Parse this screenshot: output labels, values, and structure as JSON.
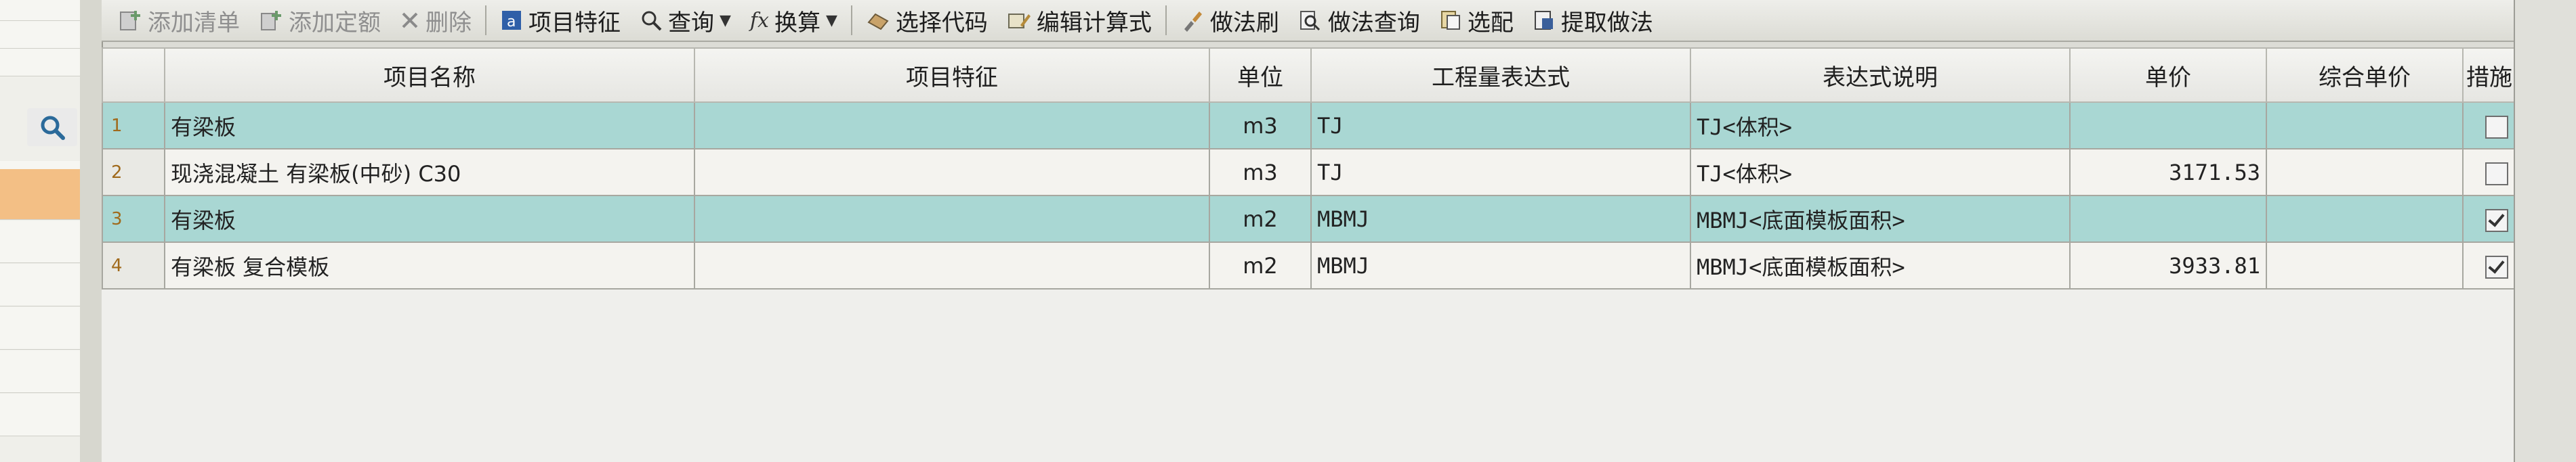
{
  "toolbar": {
    "items": [
      {
        "label": "添加清单",
        "icon": "add-list-icon",
        "disabled": true
      },
      {
        "label": "添加定额",
        "icon": "add-quota-icon",
        "disabled": true
      },
      {
        "label": "删除",
        "icon": "delete-icon",
        "disabled": true
      },
      {
        "label": "项目特征",
        "icon": "item-feature-icon",
        "disabled": false
      },
      {
        "label": "查询",
        "icon": "search-icon",
        "disabled": false,
        "dropdown": true
      },
      {
        "label": "换算",
        "icon": "formula-icon",
        "disabled": false,
        "dropdown": true
      },
      {
        "label": "选择代码",
        "icon": "select-code-icon",
        "disabled": false
      },
      {
        "label": "编辑计算式",
        "icon": "edit-formula-icon",
        "disabled": false
      },
      {
        "label": "做法刷",
        "icon": "method-brush-icon",
        "disabled": false
      },
      {
        "label": "做法查询",
        "icon": "method-query-icon",
        "disabled": false
      },
      {
        "label": "选配",
        "icon": "match-icon",
        "disabled": false
      },
      {
        "label": "提取做法",
        "icon": "extract-method-icon",
        "disabled": false
      }
    ],
    "formula_glyph": "fx"
  },
  "grid": {
    "columns": [
      "",
      "项目名称",
      "项目特征",
      "单位",
      "工程量表达式",
      "表达式说明",
      "单价",
      "综合单价",
      "措施"
    ],
    "rows": [
      {
        "num": "1",
        "name": "有梁板",
        "feature": "",
        "unit": "m3",
        "expr": "TJ",
        "desc": "TJ<体积>",
        "price": "",
        "total": "",
        "measure": false,
        "highlight": true
      },
      {
        "num": "2",
        "name": "现浇混凝土 有梁板(中砂) C30",
        "feature": "",
        "unit": "m3",
        "expr": "TJ",
        "desc": "TJ<体积>",
        "price": "3171.53",
        "total": "",
        "measure": false,
        "highlight": false
      },
      {
        "num": "3",
        "name": "有梁板",
        "feature": "",
        "unit": "m2",
        "expr": "MBMJ",
        "desc": "MBMJ<底面模板面积>",
        "price": "",
        "total": "",
        "measure": true,
        "highlight": true
      },
      {
        "num": "4",
        "name": "有梁板 复合模板",
        "feature": "",
        "unit": "m2",
        "expr": "MBMJ",
        "desc": "MBMJ<底面模板面积>",
        "price": "3933.81",
        "total": "",
        "measure": true,
        "highlight": false
      }
    ]
  },
  "colors": {
    "highlight_row": "#a9d7d3",
    "left_selected": "#f3bf85"
  }
}
